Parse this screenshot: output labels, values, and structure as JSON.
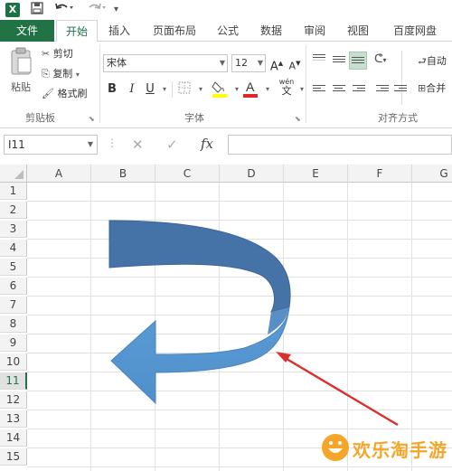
{
  "app": {
    "logo_letter": "X"
  },
  "quick_access": {
    "save_icon": "save-icon",
    "undo_icon": "undo-icon",
    "redo_icon": "redo-icon"
  },
  "tabs": [
    {
      "label": "文件"
    },
    {
      "label": "开始"
    },
    {
      "label": "插入"
    },
    {
      "label": "页面布局"
    },
    {
      "label": "公式"
    },
    {
      "label": "数据"
    },
    {
      "label": "审阅"
    },
    {
      "label": "视图"
    },
    {
      "label": "百度网盘"
    }
  ],
  "ribbon": {
    "clipboard": {
      "paste_label": "粘贴",
      "cut_label": "剪切",
      "copy_label": "复制",
      "format_painter_label": "格式刷",
      "group_label": "剪贴板"
    },
    "font": {
      "font_name": "宋体",
      "font_size": "12",
      "group_label": "字体",
      "bold": "B",
      "italic": "I",
      "underline": "U",
      "grow": "A",
      "shrink": "A",
      "wen": "wén",
      "wen_char": "文"
    },
    "alignment": {
      "group_label": "对齐方式",
      "wrap_label": "自动",
      "merge_label": "合并"
    }
  },
  "formula_bar": {
    "name_box": "I11",
    "fx": "fx",
    "cancel": "✕",
    "confirm": "✓"
  },
  "grid": {
    "columns": [
      "A",
      "B",
      "C",
      "D",
      "E",
      "F",
      "G"
    ],
    "rows": [
      "1",
      "2",
      "3",
      "4",
      "5",
      "6",
      "7",
      "8",
      "9",
      "10",
      "11",
      "12",
      "13",
      "14",
      "15"
    ],
    "selected_row": "11"
  },
  "shape": {
    "type": "curved-arrow",
    "fill_top": "#4472a8",
    "fill_bottom": "#5b9bd5"
  },
  "annotation": {
    "color": "#d9302c"
  },
  "watermark": {
    "text": "欢乐淘手游"
  },
  "colors": {
    "excel_green": "#217346",
    "accent": "#217346"
  }
}
